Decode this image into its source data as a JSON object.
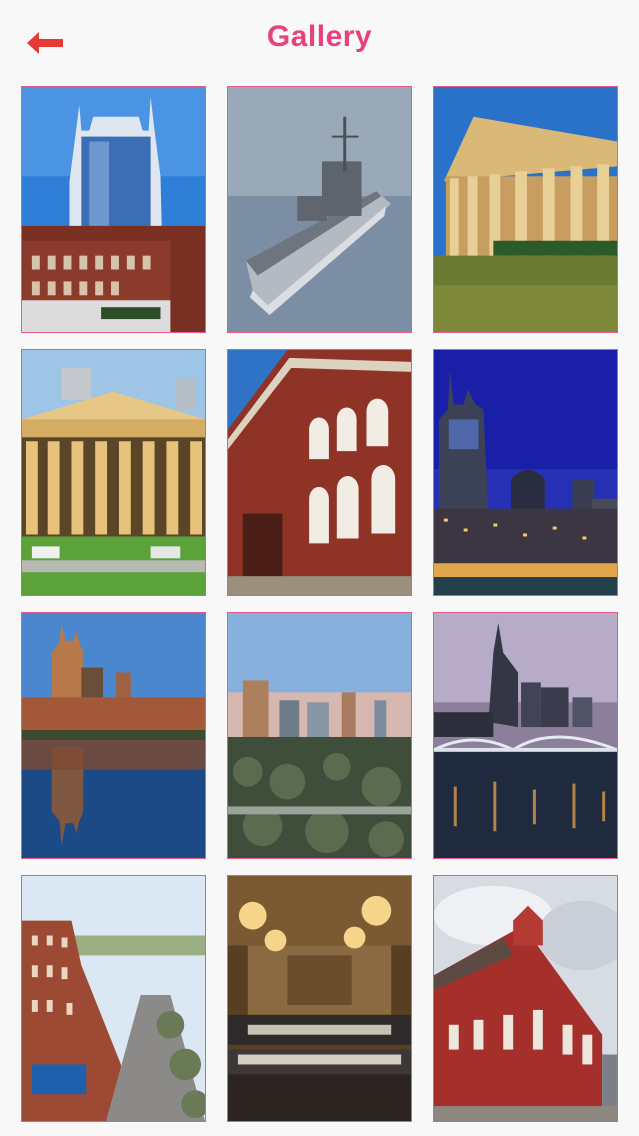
{
  "header": {
    "title": "Gallery",
    "back_icon": "back-arrow-icon"
  },
  "colors": {
    "accent": "#e8427e",
    "tile_border": "#e45b8c",
    "background": "#f8f8f9",
    "back_arrow": "#e53935"
  },
  "gallery": {
    "photos": [
      {
        "subject": "skyscraper"
      },
      {
        "subject": "warship"
      },
      {
        "subject": "parthenon"
      },
      {
        "subject": "parthenon-front"
      },
      {
        "subject": "ryman-auditorium"
      },
      {
        "subject": "night-skyline"
      },
      {
        "subject": "skyline-reflection"
      },
      {
        "subject": "dusk-skyline"
      },
      {
        "subject": "bridge-night"
      },
      {
        "subject": "street-aerial"
      },
      {
        "subject": "symphony-hall"
      },
      {
        "subject": "ryman-exterior"
      }
    ]
  }
}
